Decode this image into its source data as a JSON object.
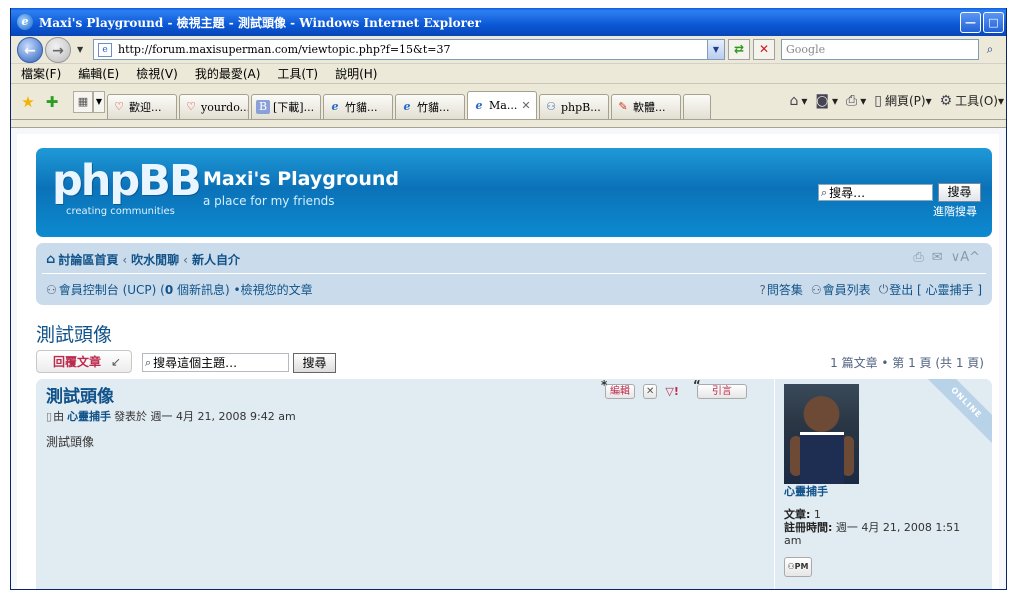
{
  "window": {
    "title": "Maxi's Playground  -  檢視主題 - 測試頭像 - Windows Internet Explorer",
    "minimize": "—",
    "maximize": "□"
  },
  "address": {
    "url": "http://forum.maxisuperman.com/viewtopic.php?f=15&t=37",
    "search_placeholder": "Google"
  },
  "menu": [
    "檔案(F)",
    "編輯(E)",
    "檢視(V)",
    "我的最愛(A)",
    "工具(T)",
    "說明(H)"
  ],
  "tabs": [
    {
      "label": "歡迎...",
      "icon": "heart-icon"
    },
    {
      "label": "yourdo...",
      "icon": "heart-icon"
    },
    {
      "label": "[下載]...",
      "icon": "blog-icon"
    },
    {
      "label": "竹貓...",
      "icon": "ie-icon"
    },
    {
      "label": "竹貓...",
      "icon": "ie-icon"
    },
    {
      "label": "Ma...",
      "icon": "ie-icon",
      "active": true
    },
    {
      "label": "phpB...",
      "icon": "people-icon"
    },
    {
      "label": "軟體...",
      "icon": "software-icon"
    }
  ],
  "tab_tools": {
    "page": "網頁(P)",
    "tools": "工具(O)"
  },
  "header": {
    "logo": "phpBB",
    "logo_tag": "creating  communities",
    "site_name": "Maxi's Playground",
    "site_desc": "a place for my friends",
    "search_value": "搜尋…",
    "search_button": "搜尋",
    "advanced_search": "進階搜尋"
  },
  "nav": {
    "crumbs": [
      "討論區首頁",
      "吹水閒聊",
      "新人自介"
    ],
    "ucp_prefix": "會員控制台 (UCP) (",
    "ucp_count": "0",
    "ucp_suffix": " 個新訊息) • ",
    "view_posts": "檢視您的文章",
    "faq": "問答集",
    "members": "會員列表",
    "logout": "登出 [ 心靈捕手 ]"
  },
  "topic": {
    "title": "測試頭像",
    "reply_button": "回覆文章",
    "search_placeholder": "搜尋這個主題…",
    "search_button": "搜尋",
    "pagination": "1 篇文章 • 第 1 頁 (共 1 頁)"
  },
  "post": {
    "title": "測試頭像",
    "meta_prefix": "由",
    "author": "心靈捕手",
    "meta_suffix": "發表於 週一 4月 21, 2008 9:42 am",
    "body": "測試頭像",
    "edit": "編輯",
    "quote": "引言",
    "online": "ONLINE",
    "profile": {
      "name": "心靈捕手",
      "posts_label": "文章:",
      "posts_value": " 1",
      "joined_label": "註冊時間:",
      "joined_value": " 週一 4月 21, 2008 1:51 am",
      "pm": "PM"
    }
  }
}
